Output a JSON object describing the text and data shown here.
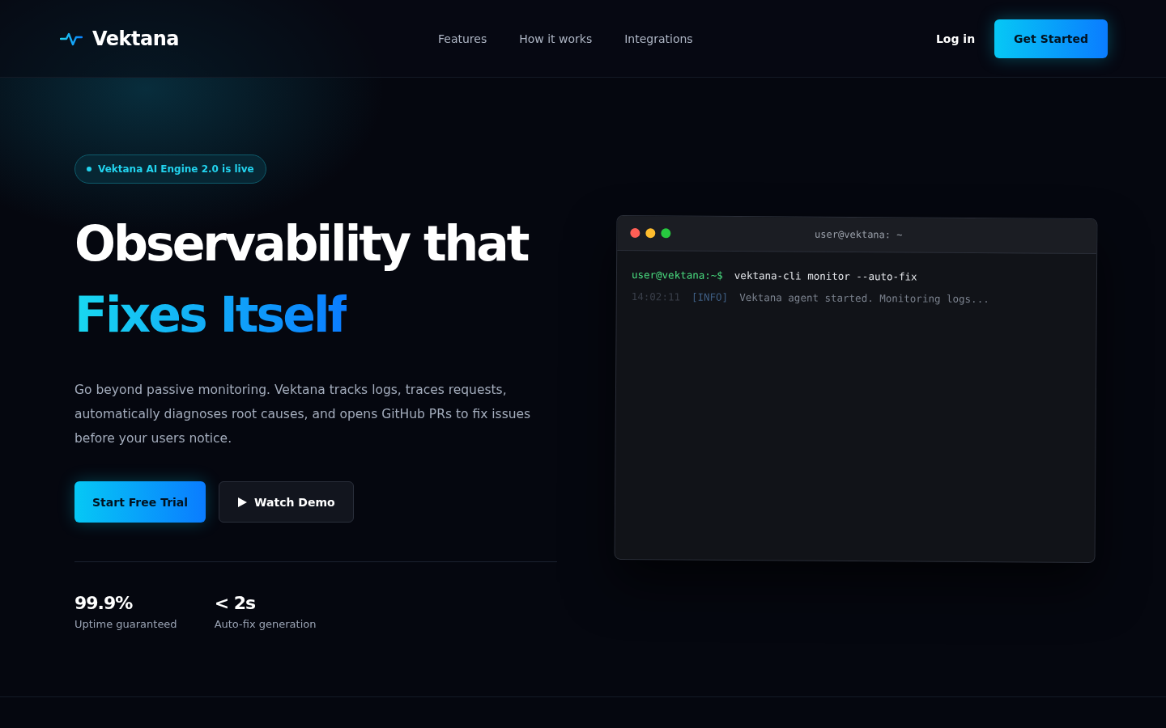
{
  "nav": {
    "brand": "Vektana",
    "links": [
      {
        "label": "Features"
      },
      {
        "label": "How it works"
      },
      {
        "label": "Integrations"
      }
    ],
    "login": "Log in",
    "cta": "Get Started"
  },
  "hero": {
    "badge": "Vektana AI Engine 2.0 is live",
    "title_line1": "Observability that",
    "title_line2": "Fixes Itself",
    "description": "Go beyond passive monitoring. Vektana tracks logs, traces requests, automatically diagnoses root causes, and opens GitHub PRs to fix issues before your users notice.",
    "primary_button": "Start Free Trial",
    "secondary_button": "Watch Demo",
    "stats": [
      {
        "value": "99.9%",
        "label": "Uptime guaranteed"
      },
      {
        "value": "< 2s",
        "label": "Auto-fix generation"
      }
    ]
  },
  "terminal": {
    "title": "user@vektana: ~",
    "prompt": "user@vektana:~$",
    "command": "vektana-cli monitor --auto-fix",
    "logs": [
      {
        "time": "14:02:11",
        "tag": "[INFO]",
        "message": "Vektana agent started. Monitoring logs..."
      }
    ]
  }
}
